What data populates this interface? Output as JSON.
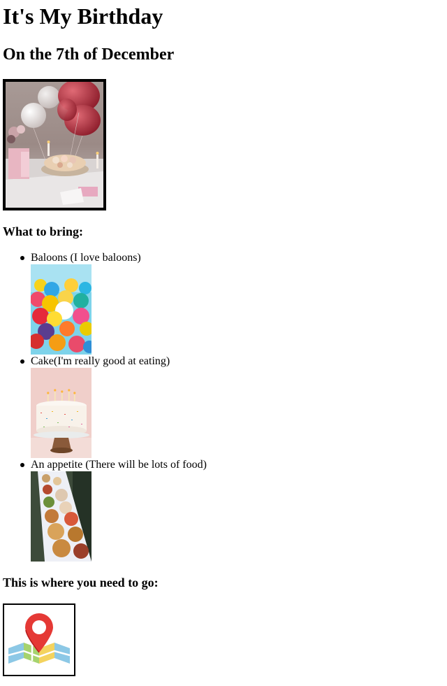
{
  "page": {
    "title": "It's My Birthday",
    "subtitle": "On the 7th of December"
  },
  "bring": {
    "heading": "What to bring:",
    "items": [
      {
        "label": "Baloons (I love baloons)",
        "image": "balloons-photo"
      },
      {
        "label": "Cake(I'm really good at eating)",
        "image": "cake-photo"
      },
      {
        "label": "An appetite (There will be lots of food)",
        "image": "food-buffet-photo"
      }
    ]
  },
  "location": {
    "heading": "This is where you need to go:",
    "icon": "map-pin-icon"
  },
  "colors": {
    "text": "#000000",
    "background": "#ffffff",
    "pin": "#e53935"
  }
}
